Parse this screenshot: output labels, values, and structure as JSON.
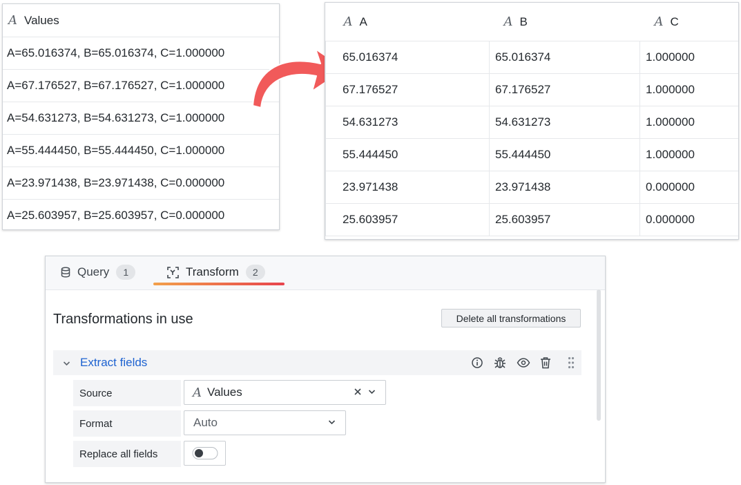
{
  "values_table": {
    "header": "Values",
    "type_icon": "A",
    "rows": [
      "A=65.016374, B=65.016374, C=1.000000",
      "A=67.176527, B=67.176527, C=1.000000",
      "A=54.631273, B=54.631273, C=1.000000",
      "A=55.444450, B=55.444450, C=1.000000",
      "A=23.971438, B=23.971438, C=0.000000",
      "A=25.603957, B=25.603957, C=0.000000"
    ]
  },
  "arrow_color": "#f15a5a",
  "result_table": {
    "columns": [
      "A",
      "B",
      "C"
    ],
    "type_icon": "A",
    "rows": [
      [
        "65.016374",
        "65.016374",
        "1.000000"
      ],
      [
        "67.176527",
        "67.176527",
        "1.000000"
      ],
      [
        "54.631273",
        "54.631273",
        "1.000000"
      ],
      [
        "55.444450",
        "55.444450",
        "1.000000"
      ],
      [
        "23.971438",
        "23.971438",
        "0.000000"
      ],
      [
        "25.603957",
        "25.603957",
        "0.000000"
      ]
    ]
  },
  "editor": {
    "tabs": [
      {
        "label": "Query",
        "count": "1",
        "icon": "database-icon"
      },
      {
        "label": "Transform",
        "count": "2",
        "icon": "transform-icon",
        "active": true
      }
    ],
    "section_title": "Transformations in use",
    "delete_all_label": "Delete all transformations",
    "transformation": {
      "name": "Extract fields",
      "actions": [
        "info-icon",
        "debug-icon",
        "eye-icon",
        "trash-icon",
        "drag-handle-icon"
      ],
      "fields": {
        "source_label": "Source",
        "source_value": "Values",
        "format_label": "Format",
        "format_value": "Auto",
        "replace_label": "Replace all fields",
        "replace_on": false
      }
    },
    "accent_color": "#1d62d0"
  }
}
